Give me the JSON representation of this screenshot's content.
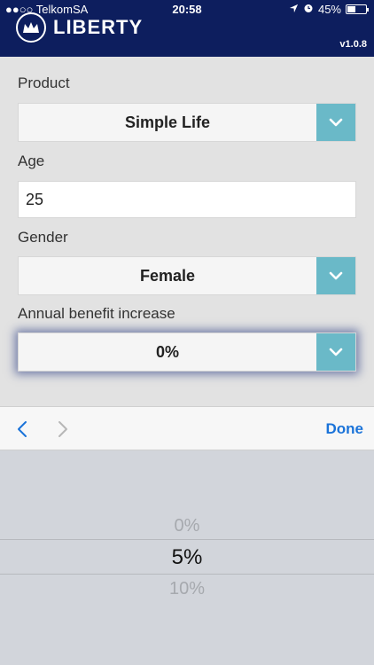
{
  "status": {
    "carrier": "●●○○ TelkomSA",
    "time": "20:58",
    "battery": "45%",
    "battery_level": 0.45
  },
  "header": {
    "brand": "LIBERTY",
    "version": "v1.0.8"
  },
  "form": {
    "product": {
      "label": "Product",
      "value": "Simple Life"
    },
    "age": {
      "label": "Age",
      "value": "25"
    },
    "gender": {
      "label": "Gender",
      "value": "Female"
    },
    "benefit": {
      "label": "Annual benefit increase",
      "value": "0%"
    }
  },
  "toolbar": {
    "done_label": "Done"
  },
  "picker": {
    "options": [
      "0%",
      "5%",
      "10%"
    ],
    "selected": "5%"
  },
  "colors": {
    "header_bg": "#0d1e5e",
    "accent": "#6ab9c8",
    "link": "#1a73d9"
  }
}
